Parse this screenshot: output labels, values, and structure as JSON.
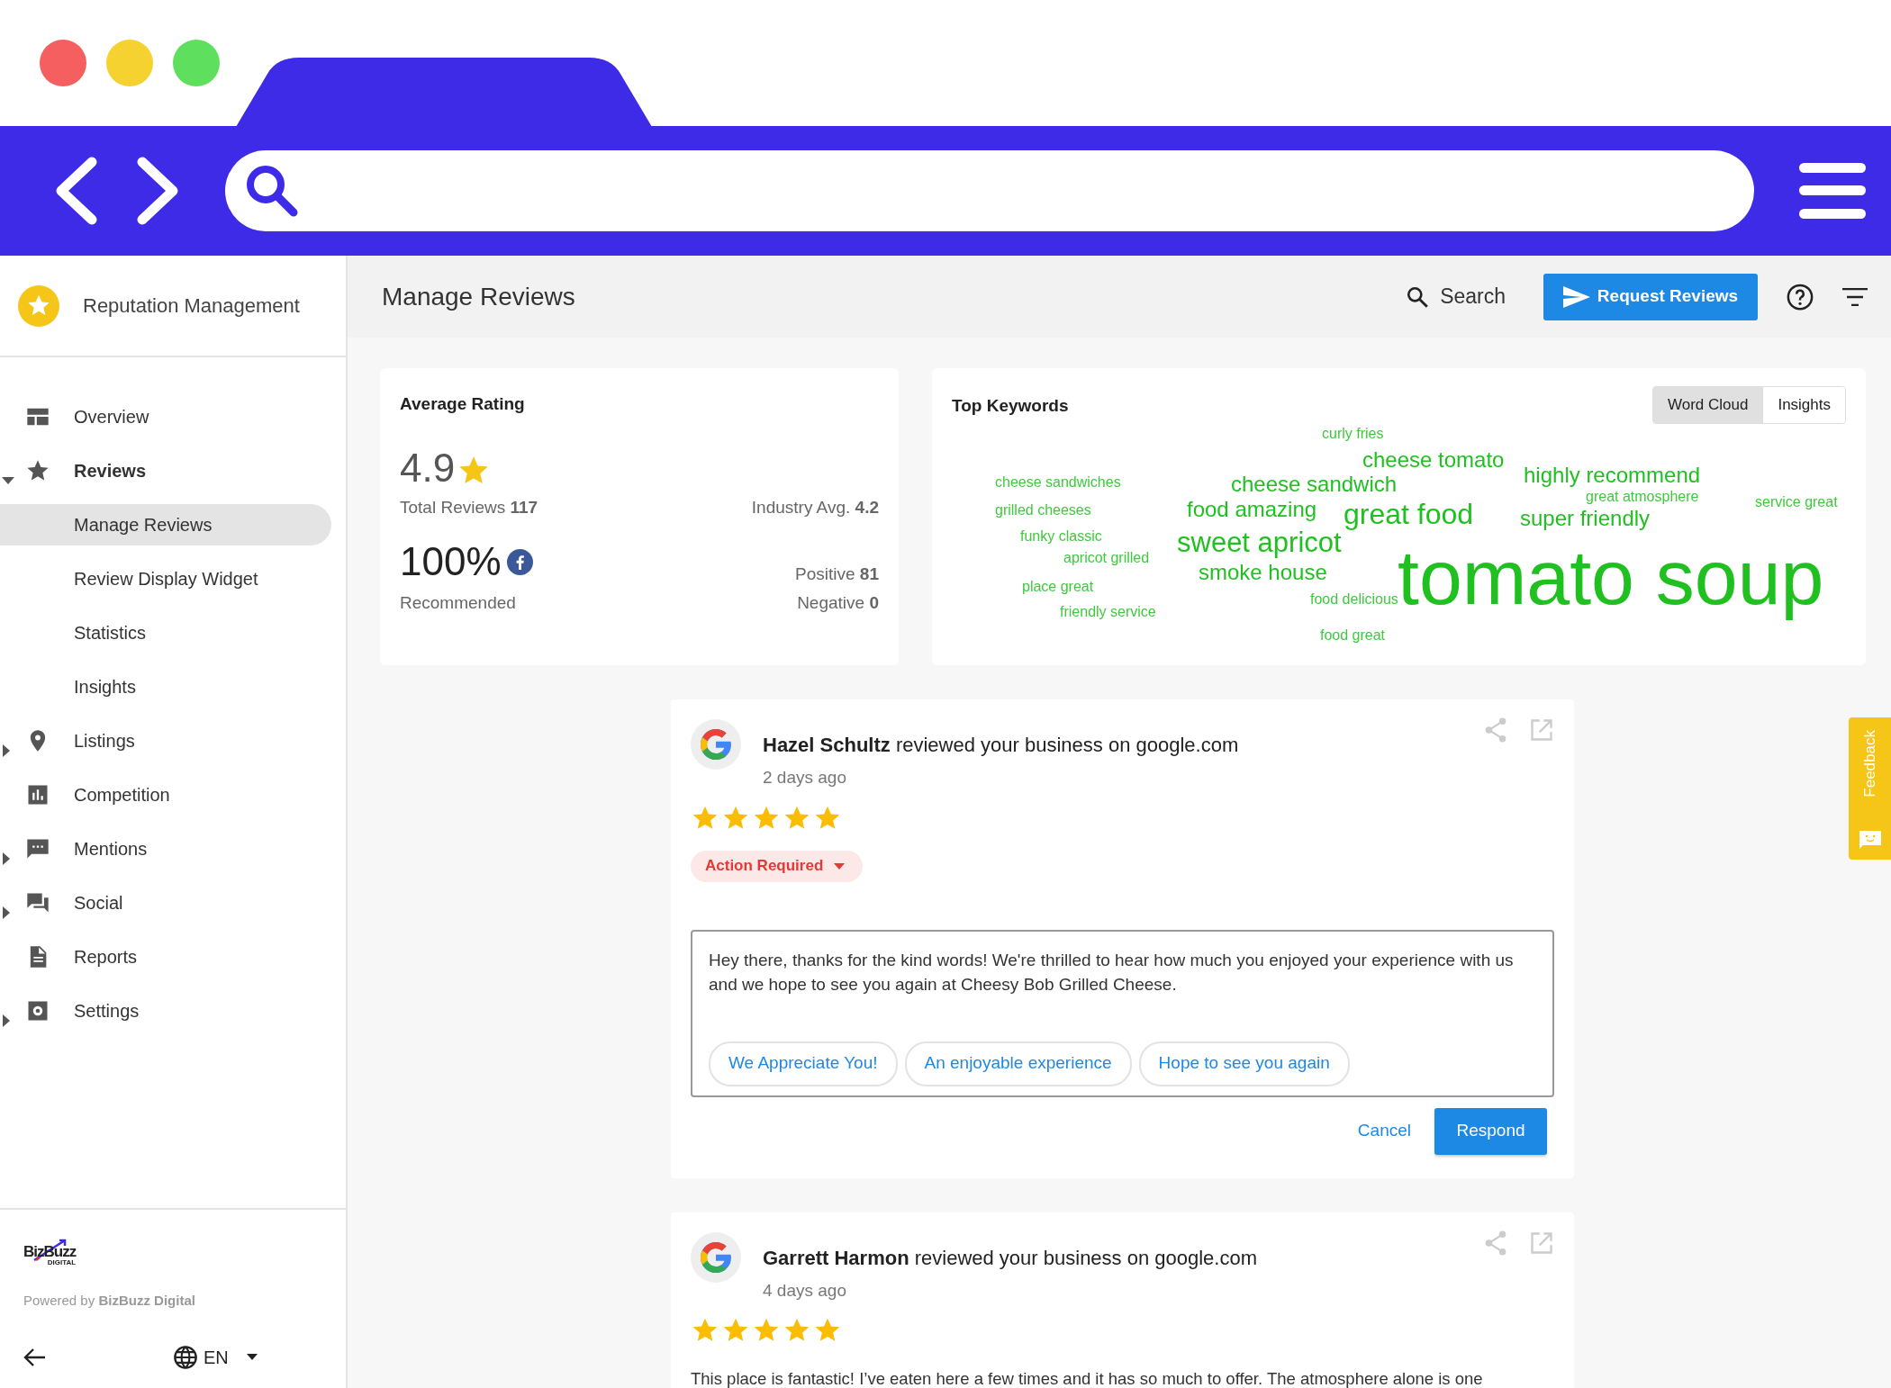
{
  "sidebar": {
    "title": "Reputation Management",
    "items": [
      {
        "label": "Overview",
        "kind": "link"
      },
      {
        "label": "Reviews",
        "kind": "group",
        "expanded": true,
        "children": [
          {
            "label": "Manage Reviews",
            "selected": true
          },
          {
            "label": "Review Display Widget",
            "selected": false
          },
          {
            "label": "Statistics",
            "selected": false
          },
          {
            "label": "Insights",
            "selected": false
          }
        ]
      },
      {
        "label": "Listings",
        "kind": "group",
        "expanded": false
      },
      {
        "label": "Competition",
        "kind": "link"
      },
      {
        "label": "Mentions",
        "kind": "group",
        "expanded": false
      },
      {
        "label": "Social",
        "kind": "group",
        "expanded": false
      },
      {
        "label": "Reports",
        "kind": "link"
      },
      {
        "label": "Settings",
        "kind": "group",
        "expanded": false
      }
    ],
    "logo": {
      "text": "BizBuzz",
      "subtext": "DIGITAL"
    },
    "powered_by": "Powered by **BizBuzz Digital**",
    "language": "EN"
  },
  "header": {
    "title": "Manage Reviews",
    "search": "Search",
    "request_button": "Request Reviews"
  },
  "average_rating": {
    "title": "Average Rating",
    "rating": "4.9",
    "total": "Total Reviews **117**",
    "industry": "Industry Avg. **4.2**",
    "percent": "100%",
    "recommended": "Recommended",
    "positive": "Positive **81**",
    "negative": "Negative **0**"
  },
  "top_keywords": {
    "title": "Top Keywords",
    "views": [
      {
        "label": "Word Cloud",
        "selected": true
      },
      {
        "label": "Insights",
        "selected": false
      }
    ],
    "words": [
      "curly fries",
      "cheese tomato",
      "cheese sandwiches",
      "cheese sandwich",
      "highly recommend",
      "great atmosphere",
      "service great",
      "grilled cheeses",
      "food amazing",
      "great food",
      "super friendly",
      "funky classic",
      "sweet apricot",
      "apricot grilled",
      "smoke house",
      "place great",
      "food delicious",
      "friendly service",
      "tomato soup",
      "food great"
    ]
  },
  "reviews": [
    {
      "headline": "**Hazel Schultz** reviewed your business on google.com",
      "time": "2 days ago",
      "stars": 5,
      "status": "Action Required",
      "reply": {
        "text": "Hey there, thanks for the kind words! We're thrilled to hear how much you enjoyed your experience with us and we hope to see you again at Cheesy Bob Grilled Cheese.",
        "suggestions": [
          "We Appreciate You!",
          "An enjoyable experience",
          "Hope to see you again"
        ],
        "cancel": "Cancel",
        "respond": "Respond"
      }
    },
    {
      "headline": "**Garrett Harmon** reviewed your business on google.com",
      "time": "4 days ago",
      "stars": 5,
      "body": "This place is fantastic! I’ve eaten here a few times and it has so much to offer. The atmosphere alone is one"
    }
  ],
  "feedback": "Feedback"
}
